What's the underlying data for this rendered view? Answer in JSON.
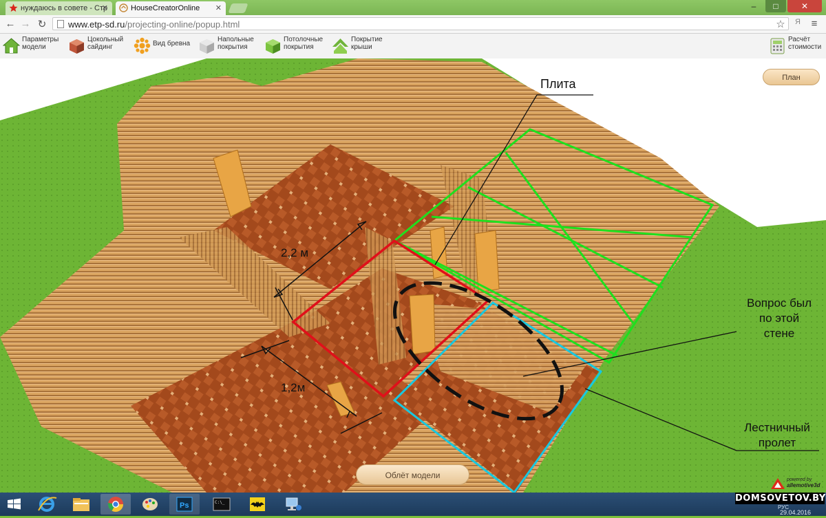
{
  "browser": {
    "tabs": [
      {
        "label": "нуждаюсь в совете - Стр",
        "active": false
      },
      {
        "label": "HouseCreatorOnline",
        "active": true
      }
    ],
    "address": {
      "host": "www.etp-sd.ru",
      "path": "/projecting-online/popup.html"
    },
    "window_buttons": [
      "–",
      "□",
      "✕"
    ]
  },
  "toolbar": {
    "items": [
      {
        "label_line1": "Параметры",
        "label_line2": "модели",
        "icon": "house-params-icon"
      },
      {
        "label_line1": "Цокольный",
        "label_line2": "сайдинг",
        "icon": "siding-icon"
      },
      {
        "label_line1": "Вид бревна",
        "label_line2": "",
        "icon": "log-type-icon"
      },
      {
        "label_line1": "Напольные",
        "label_line2": "покрытия",
        "icon": "floor-cover-icon"
      },
      {
        "label_line1": "Потолочные",
        "label_line2": "покрытия",
        "icon": "ceiling-cover-icon"
      },
      {
        "label_line1": "Покрытие",
        "label_line2": "крыши",
        "icon": "roof-cover-icon"
      }
    ],
    "cost": {
      "label_line1": "Расчёт",
      "label_line2": "стоимости",
      "icon": "calculator-icon"
    }
  },
  "scene": {
    "plan_button": "План",
    "flyover_button": "Облёт модели",
    "annotations": {
      "plate": "Плита",
      "dim_long": "2,2 м",
      "dim_short": "1,2м",
      "question_lines": [
        "Вопрос был",
        "по этой",
        "стене"
      ],
      "stair_lines": [
        "Лестничный",
        "пролет"
      ]
    },
    "powered_by": [
      "powered by",
      "allemotive3d"
    ],
    "colors": {
      "red_box": "#e0101a",
      "green_frame": "#1ee01e",
      "cyan_box": "#18c8e0",
      "log": "#d59d58",
      "floor": "#a54f1e"
    }
  },
  "taskbar": {
    "apps": [
      "windows-start-icon",
      "ie-icon",
      "explorer-icon",
      "chrome-icon",
      "paint-icon",
      "photoshop-icon",
      "cmd-icon",
      "batman-icon",
      "network-icon"
    ],
    "watermark": "DOMSOVETOV.BY",
    "tray_lang": "РУС",
    "date": "29.04.2016"
  }
}
